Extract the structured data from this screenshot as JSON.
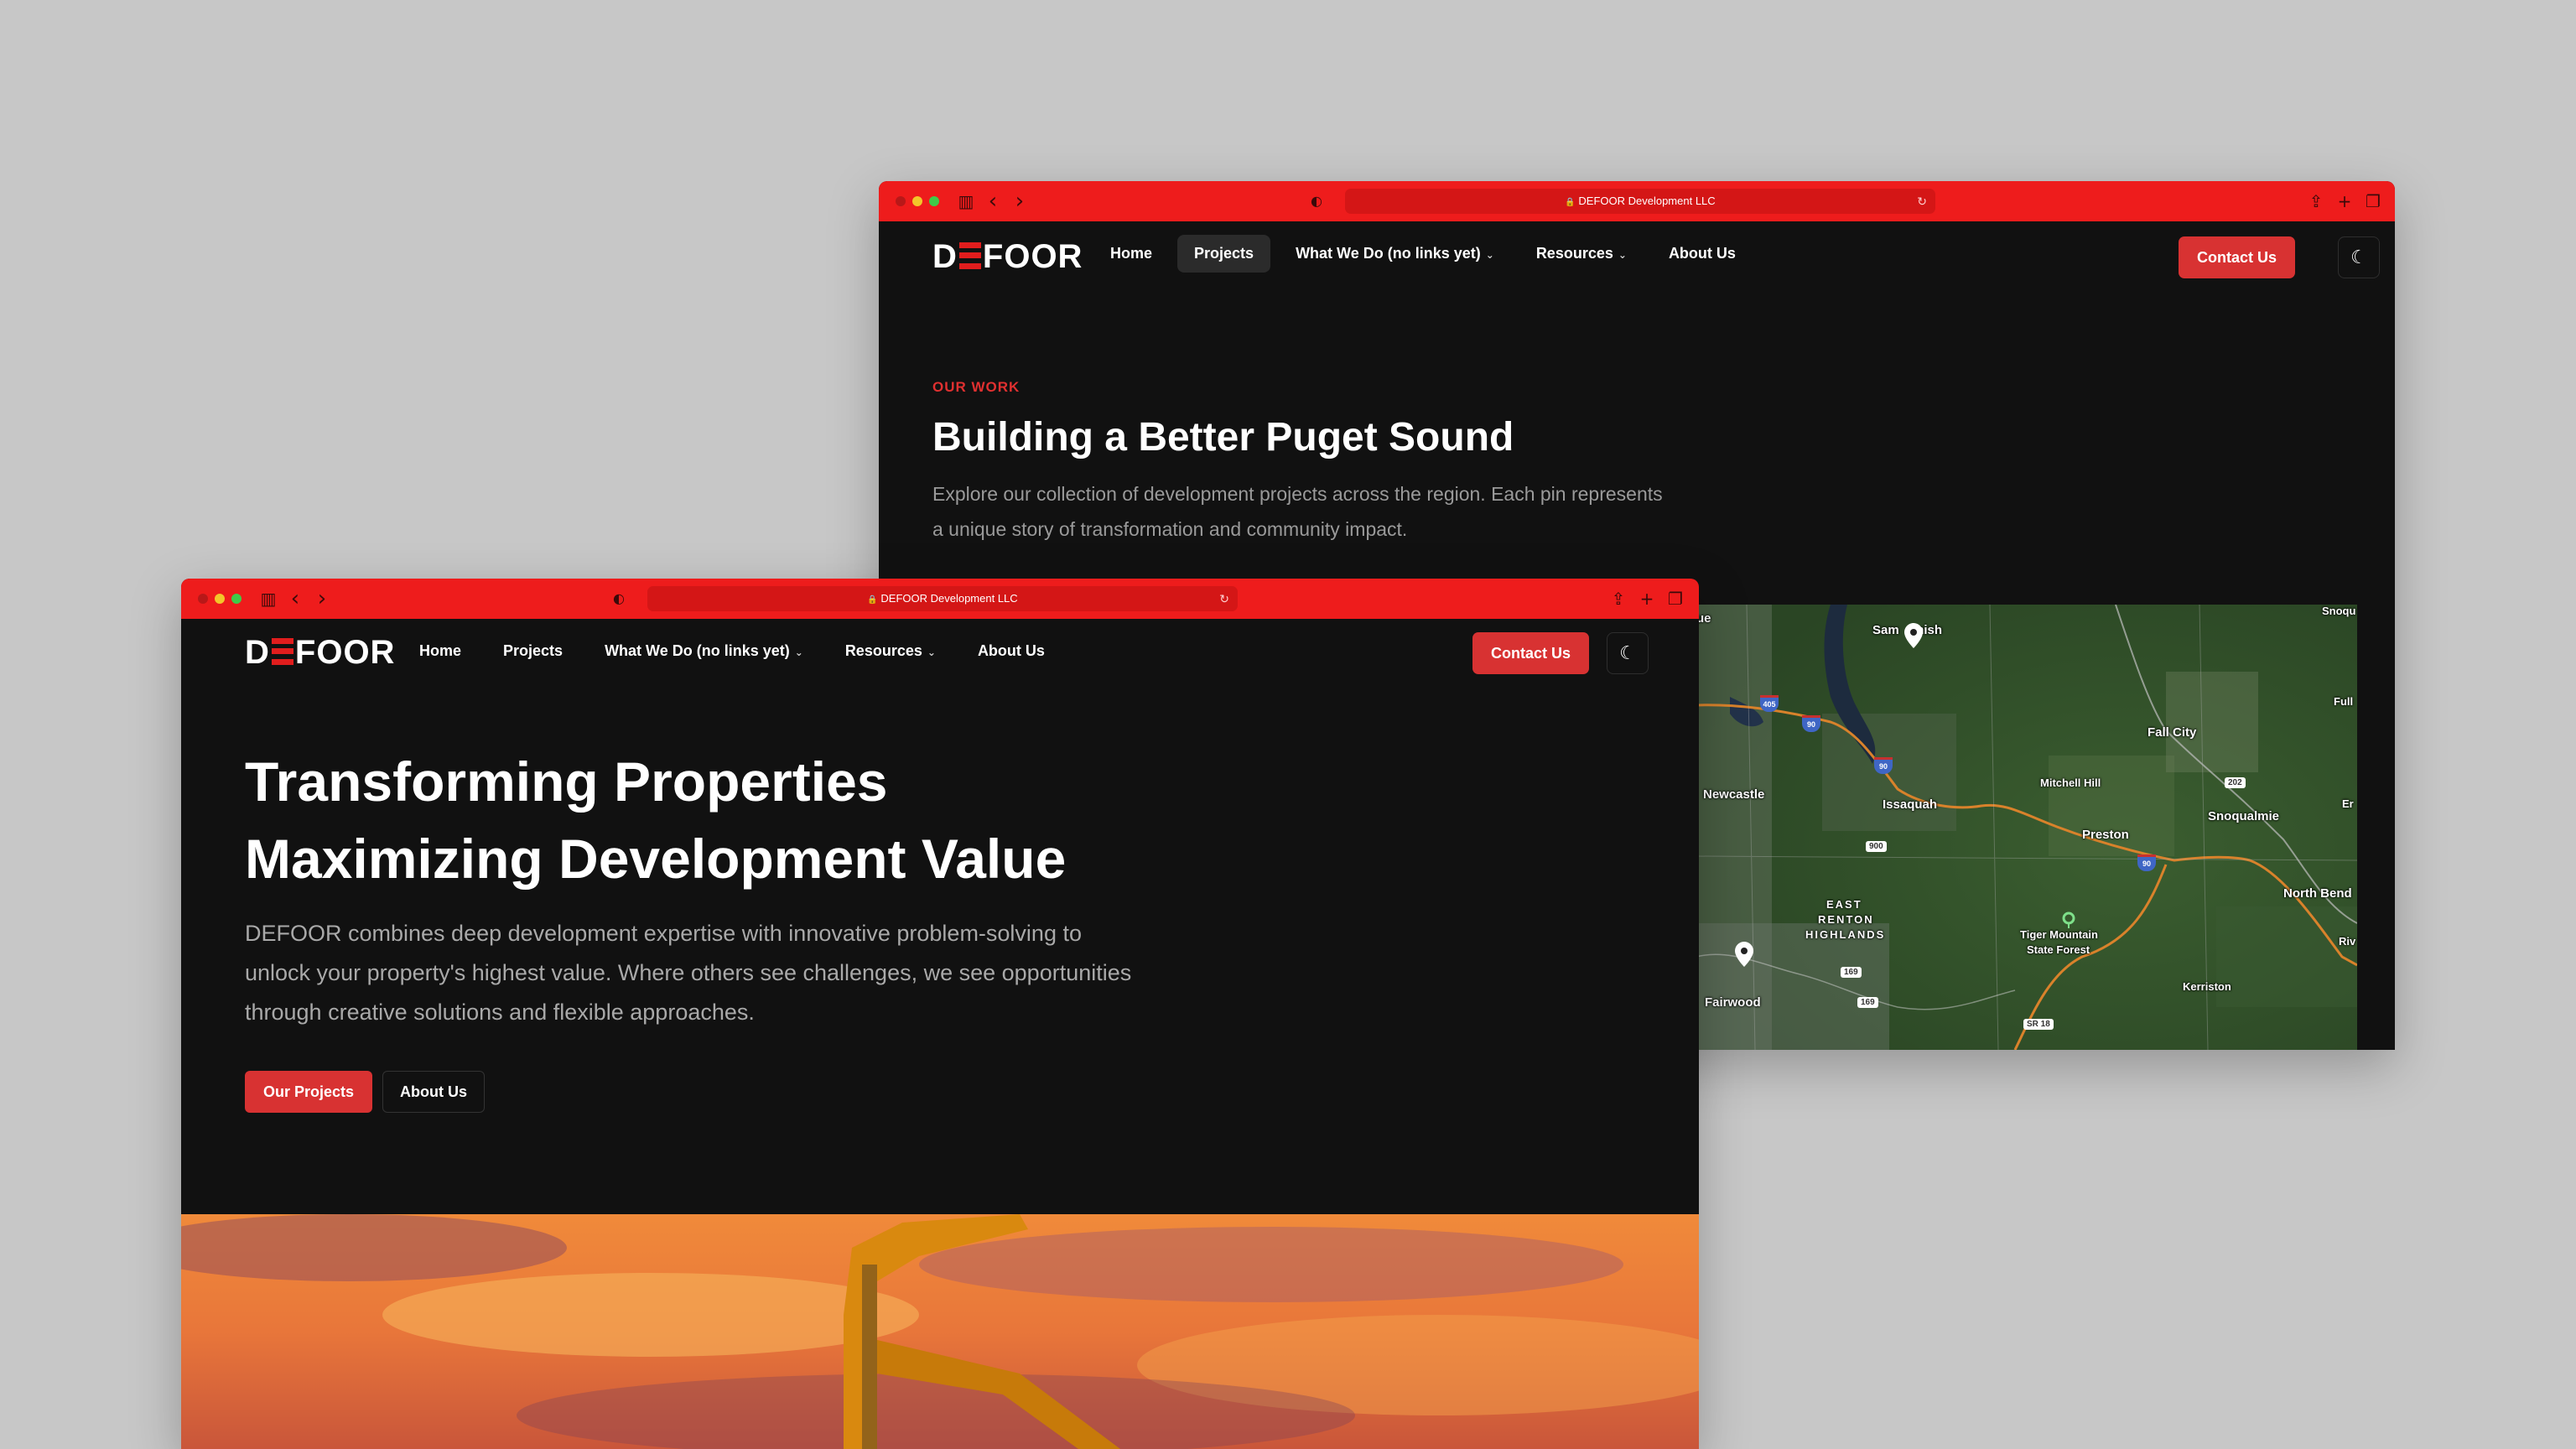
{
  "back_window": {
    "url": "DEFOOR Development LLC",
    "logo": {
      "left": "D",
      "right": "FOOR"
    },
    "nav": [
      {
        "label": "Home",
        "dropdown": false,
        "active": false
      },
      {
        "label": "Projects",
        "dropdown": false,
        "active": true
      },
      {
        "label": "What We Do (no links yet)",
        "dropdown": true,
        "active": false
      },
      {
        "label": "Resources",
        "dropdown": true,
        "active": false
      },
      {
        "label": "About Us",
        "dropdown": false,
        "active": false
      }
    ],
    "contact_label": "Contact Us",
    "eyebrow": "OUR WORK",
    "title": "Building a Better Puget Sound",
    "desc_line1": "Explore our collection of development projects across the region. Each pin represents",
    "desc_line2": "a unique story of transformation and community impact.",
    "map": {
      "labels": {
        "sammamish_a": "Sam",
        "sammamish_b": "mish",
        "snoqu": "Snoqu",
        "fall_city": "Fall City",
        "fulle": "Full",
        "mitchell_hill": "Mitchell Hill",
        "newcastle": "Newcastle",
        "issaquah": "Issaquah",
        "snoqualmie": "Snoqualmie",
        "er": "Er",
        "preston": "Preston",
        "north_bend": "North Bend",
        "east_renton": "EAST",
        "renton": "RENTON",
        "highlands": "HIGHLANDS",
        "tiger_mountain": "Tiger Mountain",
        "state_forest": "State Forest",
        "riv": "Riv",
        "fairwood": "Fairwood",
        "kerriston": "Kerriston",
        "ue": "ue"
      },
      "shields": {
        "s900": "900",
        "s169a": "169",
        "s169b": "169",
        "s202": "202",
        "sr18": "SR 18",
        "i90a": "90",
        "i90b": "90",
        "i90c": "90",
        "i405": "405"
      }
    }
  },
  "front_window": {
    "url": "DEFOOR Development LLC",
    "logo": {
      "left": "D",
      "right": "FOOR"
    },
    "nav": [
      {
        "label": "Home",
        "dropdown": false
      },
      {
        "label": "Projects",
        "dropdown": false
      },
      {
        "label": "What We Do (no links yet)",
        "dropdown": true
      },
      {
        "label": "Resources",
        "dropdown": true
      },
      {
        "label": "About Us",
        "dropdown": false
      }
    ],
    "contact_label": "Contact Us",
    "hero_line1": "Transforming Properties",
    "hero_line2": "Maximizing Development Value",
    "hero_p1": "DEFOOR combines deep development expertise with innovative problem-solving to",
    "hero_p2": "unlock your property's highest value. Where others see challenges, we see opportunities",
    "hero_p3": "through creative solutions and flexible approaches.",
    "btn_projects": "Our Projects",
    "btn_about": "About Us"
  },
  "icons": {
    "chevron": "⌄",
    "moon": "☾",
    "lock": "🔒",
    "reload": "↻",
    "shield": "◐",
    "back": "‹",
    "forward": "›",
    "share": "⇪",
    "plus": "+",
    "tabs": "❐",
    "sidebar": "▥"
  },
  "colors": {
    "accent": "#d83232",
    "chrome": "#ee1c1c",
    "bg": "#111111"
  }
}
